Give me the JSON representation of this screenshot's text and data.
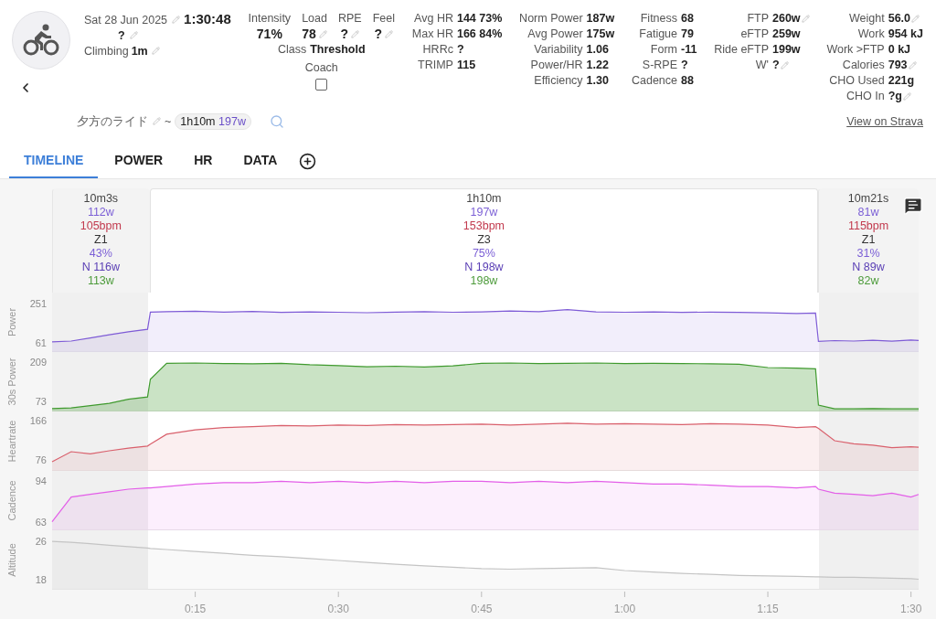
{
  "activity": {
    "date": "Sat 28 Jun 2025",
    "date_editable": true,
    "duration": "1:30:48",
    "description": "?",
    "description_editable": true,
    "climbing": {
      "label": "Climbing",
      "value": "1m",
      "editable": true
    }
  },
  "load_stats": [
    {
      "label": "Intensity",
      "value": "71%",
      "editable": false
    },
    {
      "label": "Load",
      "value": "78",
      "editable": true
    },
    {
      "label": "RPE",
      "value": "?",
      "editable": true
    },
    {
      "label": "Feel",
      "value": "?",
      "editable": true
    }
  ],
  "class": {
    "label": "Class",
    "value": "Threshold"
  },
  "coach": {
    "label": "Coach",
    "checked": false
  },
  "stat_columns": [
    [
      {
        "label": "Avg HR",
        "value": "144 73%",
        "editable": false
      },
      {
        "label": "Max HR",
        "value": "166 84%",
        "editable": false
      },
      {
        "label": "HRRc",
        "value": "?",
        "editable": false
      },
      {
        "label": "TRIMP",
        "value": "115",
        "editable": false
      }
    ],
    [
      {
        "label": "Norm Power",
        "value": "187w",
        "editable": false
      },
      {
        "label": "Avg Power",
        "value": "175w",
        "editable": false
      },
      {
        "label": "Variability",
        "value": "1.06",
        "editable": false
      },
      {
        "label": "Power/HR",
        "value": "1.22",
        "editable": false
      },
      {
        "label": "Efficiency",
        "value": "1.30",
        "editable": false
      }
    ],
    [
      {
        "label": "Fitness",
        "value": "68",
        "editable": false
      },
      {
        "label": "Fatigue",
        "value": "79",
        "editable": false
      },
      {
        "label": "Form",
        "value": "-11",
        "editable": false
      },
      {
        "label": "S-RPE",
        "value": "?",
        "editable": false
      },
      {
        "label": "Cadence",
        "value": "88",
        "editable": false
      }
    ],
    [
      {
        "label": "FTP",
        "value": "260w",
        "editable": true
      },
      {
        "label": "eFTP",
        "value": "259w",
        "editable": false
      },
      {
        "label": "Ride eFTP",
        "value": "199w",
        "editable": false
      },
      {
        "label": "W'",
        "value": "?",
        "editable": true
      }
    ],
    [
      {
        "label": "Weight",
        "value": "56.0",
        "editable": true
      },
      {
        "label": "Work",
        "value": "954 kJ",
        "editable": false
      },
      {
        "label": "Work >FTP",
        "value": "0 kJ",
        "editable": false
      },
      {
        "label": "Calories",
        "value": "793",
        "editable": true
      },
      {
        "label": "CHO Used",
        "value": "221g",
        "editable": false
      },
      {
        "label": "CHO In",
        "value": "?g",
        "editable": true
      }
    ]
  ],
  "title": {
    "name": "夕方のライド",
    "editable": true,
    "separator": "~",
    "chip_duration": "1h10m",
    "chip_power": "197w"
  },
  "strava_link": "View on Strava",
  "tabs": [
    {
      "label": "TIMELINE",
      "selected": true
    },
    {
      "label": "POWER",
      "selected": false
    },
    {
      "label": "HR",
      "selected": false
    },
    {
      "label": "DATA",
      "selected": false
    }
  ],
  "intervals": [
    {
      "duration": "10m3s",
      "avg_power": "112w",
      "avg_hr": "105bpm",
      "zone": "Z1",
      "intensity": "43%",
      "norm_power": "N 116w",
      "extra": "113w",
      "selected": false
    },
    {
      "duration": "1h10m",
      "avg_power": "197w",
      "avg_hr": "153bpm",
      "zone": "Z3",
      "intensity": "75%",
      "norm_power": "N 198w",
      "extra": "198w",
      "selected": true
    },
    {
      "duration": "10m21s",
      "avg_power": "81w",
      "avg_hr": "115bpm",
      "zone": "Z1",
      "intensity": "31%",
      "norm_power": "N 89w",
      "extra": "82w",
      "selected": false
    }
  ],
  "charts": [
    {
      "chart_data": {
        "type": "area",
        "ylabel": "Power",
        "x": [
          0,
          2,
          4,
          6,
          8,
          10,
          10.3,
          12,
          15,
          18,
          21,
          24,
          27,
          30,
          33,
          36,
          39,
          42,
          45,
          48,
          51,
          54,
          57,
          60,
          63,
          66,
          69,
          72,
          75,
          78,
          80,
          80.3,
          82,
          84,
          86,
          88,
          90,
          90.8
        ],
        "xlim": [
          0,
          90.8
        ],
        "ylim": [
          17,
          304
        ],
        "yticks": [
          61,
          251
        ],
        "series": [
          {
            "color": "#7e5bd6",
            "values": [
              66,
              70,
              85,
              100,
              115,
              127,
              210,
              212,
              214,
              210,
              213,
              208,
              211,
              209,
              207,
              210,
              212,
              209,
              211,
              215,
              212,
              222,
              211,
              209,
              211,
              208,
              210,
              208,
              206,
              203,
              205,
              68,
              72,
              70,
              74,
              69,
              75,
              73
            ]
          }
        ]
      }
    },
    {
      "chart_data": {
        "type": "area",
        "ylabel": "30s Power",
        "x": [
          0,
          2,
          4,
          6,
          8,
          10,
          10.3,
          12,
          15,
          18,
          21,
          24,
          27,
          30,
          33,
          36,
          39,
          42,
          45,
          48,
          51,
          54,
          57,
          60,
          63,
          66,
          69,
          72,
          75,
          78,
          80,
          80.3,
          82,
          84,
          86,
          88,
          90,
          90.8
        ],
        "xlim": [
          0,
          90.8
        ],
        "ylim": [
          38,
          244
        ],
        "yticks": [
          73,
          209
        ],
        "series": [
          {
            "color": "#3f9a2e",
            "values": [
              48,
              50,
              58,
              66,
              80,
              88,
              150,
              205,
              206,
              204,
              203,
              205,
              200,
              197,
              193,
              195,
              192,
              196,
              205,
              206,
              204,
              205,
              206,
              204,
              205,
              204,
              203,
              202,
              190,
              188,
              186,
              60,
              47,
              47,
              48,
              47,
              47,
              47
            ]
          }
        ]
      }
    },
    {
      "chart_data": {
        "type": "area",
        "ylabel": "Heartrate",
        "x": [
          0,
          2,
          4,
          6,
          8,
          10,
          10.3,
          12,
          15,
          18,
          21,
          24,
          27,
          30,
          33,
          36,
          39,
          42,
          45,
          48,
          51,
          54,
          57,
          60,
          63,
          66,
          69,
          72,
          75,
          78,
          80,
          80.3,
          82,
          84,
          86,
          88,
          90,
          90.8
        ],
        "xlim": [
          0,
          90.8
        ],
        "ylim": [
          51,
          187
        ],
        "yticks": [
          76,
          166
        ],
        "series": [
          {
            "color": "#d9606c",
            "values": [
              72,
              95,
              90,
              97,
              103,
              108,
              112,
              135,
              145,
              150,
              152,
              155,
              154,
              156,
              155,
              157,
              156,
              157,
              158,
              156,
              158,
              160,
              158,
              159,
              158,
              157,
              159,
              158,
              156,
              150,
              152,
              148,
              120,
              113,
              110,
              104,
              106,
              105
            ]
          }
        ]
      }
    },
    {
      "chart_data": {
        "type": "area",
        "ylabel": "Cadence",
        "x": [
          0,
          2,
          4,
          6,
          8,
          10,
          10.3,
          12,
          15,
          18,
          21,
          24,
          27,
          30,
          33,
          36,
          39,
          42,
          45,
          48,
          51,
          54,
          57,
          60,
          63,
          66,
          69,
          72,
          75,
          78,
          80,
          80.3,
          82,
          84,
          86,
          88,
          90,
          90.8
        ],
        "xlim": [
          0,
          90.8
        ],
        "ylim": [
          56.5,
          102
        ],
        "yticks": [
          63,
          94
        ],
        "series": [
          {
            "color": "#e35ee8",
            "values": [
              63,
              82,
              84,
              86,
              88,
              89,
              89,
              90,
              92,
              93,
              93,
              94,
              93,
              94,
              93,
              94,
              93,
              94,
              94,
              93,
              94,
              93,
              94,
              93,
              92,
              92,
              91,
              90,
              90,
              89,
              90,
              88,
              85,
              84,
              83,
              85,
              82,
              84
            ]
          }
        ]
      }
    },
    {
      "chart_data": {
        "type": "area",
        "ylabel": "Altitude",
        "x": [
          0,
          2,
          4,
          6,
          8,
          10,
          10.3,
          12,
          15,
          18,
          21,
          24,
          27,
          30,
          33,
          36,
          39,
          42,
          45,
          48,
          51,
          54,
          57,
          60,
          63,
          66,
          69,
          72,
          75,
          78,
          80,
          80.3,
          82,
          84,
          86,
          88,
          90,
          90.8
        ],
        "xlim": [
          0,
          90.8
        ],
        "ylim": [
          15.9,
          28.3
        ],
        "yticks": [
          18,
          26
        ],
        "xticks": [
          {
            "value": 15,
            "label": "0:15"
          },
          {
            "value": 30,
            "label": "0:30"
          },
          {
            "value": 45,
            "label": "0:45"
          },
          {
            "value": 60,
            "label": "1:00"
          },
          {
            "value": 75,
            "label": "1:15"
          },
          {
            "value": 90,
            "label": "1:30"
          }
        ],
        "series": [
          {
            "color": "#c4c4c4",
            "values": [
              26,
              25.8,
              25.5,
              25.2,
              24.9,
              24.6,
              24.5,
              24.3,
              23.9,
              23.5,
              23.1,
              22.8,
              22.4,
              22.0,
              21.6,
              21.2,
              20.9,
              20.6,
              20.3,
              20.2,
              20.3,
              20.4,
              20.5,
              19.9,
              19.6,
              19.3,
              19.1,
              18.9,
              18.8,
              18.7,
              18.6,
              18.6,
              18.5,
              18.5,
              18.4,
              18.3,
              18.2,
              18.1
            ]
          }
        ]
      }
    }
  ]
}
